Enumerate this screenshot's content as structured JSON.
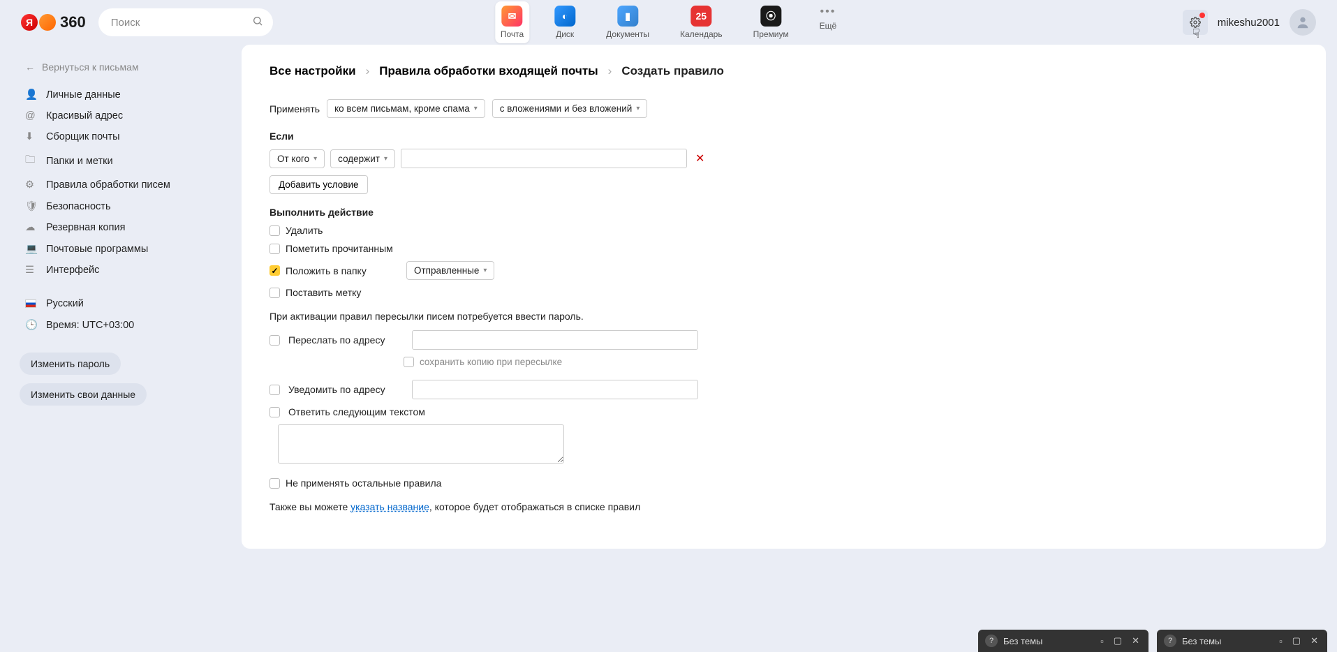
{
  "header": {
    "logo_text": "360",
    "search_placeholder": "Поиск",
    "apps": [
      {
        "label": "Почта",
        "active": true
      },
      {
        "label": "Диск"
      },
      {
        "label": "Документы"
      },
      {
        "label": "Календарь",
        "badge": "25"
      },
      {
        "label": "Премиум"
      }
    ],
    "more_label": "Ещё",
    "username": "mikeshu2001"
  },
  "sidebar": {
    "back_label": "Вернуться к письмам",
    "items": [
      "Личные данные",
      "Красивый адрес",
      "Сборщик почты",
      "Папки и метки",
      "Правила обработки писем",
      "Безопасность",
      "Резервная копия",
      "Почтовые программы",
      "Интерфейс"
    ],
    "language": "Русский",
    "timezone": "Время: UTC+03:00",
    "change_password": "Изменить пароль",
    "change_data": "Изменить свои данные"
  },
  "breadcrumb": {
    "a": "Все настройки",
    "b": "Правила обработки входящей почты",
    "c": "Создать правило"
  },
  "form": {
    "apply_label": "Применять",
    "apply_select1": "ко всем письмам, кроме спама",
    "apply_select2": "с вложениями и без вложений",
    "if_title": "Если",
    "cond_field": "От кого",
    "cond_op": "содержит",
    "add_condition": "Добавить условие",
    "action_title": "Выполнить действие",
    "act_delete": "Удалить",
    "act_read": "Пометить прочитанным",
    "act_folder": "Положить в папку",
    "folder_select": "Отправленные",
    "act_label": "Поставить метку",
    "forward_note": "При активации правил пересылки писем потребуется ввести пароль.",
    "act_forward": "Переслать по адресу",
    "act_forward_copy": "сохранить копию при пересылке",
    "act_notify": "Уведомить по адресу",
    "act_reply": "Ответить следующим текстом",
    "act_stop": "Не применять остальные правила",
    "name_prefix": "Также вы можете ",
    "name_link": "указать название",
    "name_suffix": ", которое будет отображаться в списке правил"
  },
  "panels": {
    "title": "Без темы"
  }
}
